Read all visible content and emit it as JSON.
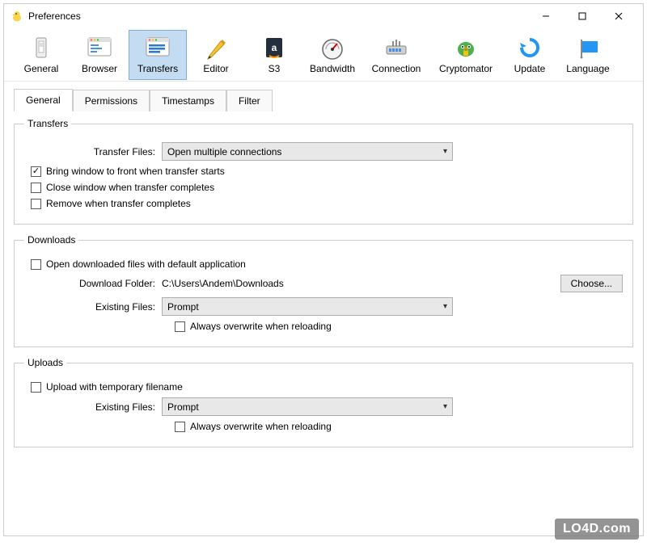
{
  "window": {
    "title": "Preferences"
  },
  "toolbar": {
    "items": [
      {
        "label": "General"
      },
      {
        "label": "Browser"
      },
      {
        "label": "Transfers"
      },
      {
        "label": "Editor"
      },
      {
        "label": "S3"
      },
      {
        "label": "Bandwidth"
      },
      {
        "label": "Connection"
      },
      {
        "label": "Cryptomator"
      },
      {
        "label": "Update"
      },
      {
        "label": "Language"
      }
    ]
  },
  "subtabs": {
    "items": [
      {
        "label": "General"
      },
      {
        "label": "Permissions"
      },
      {
        "label": "Timestamps"
      },
      {
        "label": "Filter"
      }
    ]
  },
  "transfers_group": {
    "legend": "Transfers",
    "transfer_files_label": "Transfer Files:",
    "transfer_files_value": "Open multiple connections",
    "cb_bring_front": "Bring window to front when transfer starts",
    "cb_close_complete": "Close window when transfer completes",
    "cb_remove_complete": "Remove when transfer completes"
  },
  "downloads_group": {
    "legend": "Downloads",
    "cb_open_default": "Open downloaded files with default application",
    "download_folder_label": "Download Folder:",
    "download_folder_value": "C:\\Users\\Andem\\Downloads",
    "choose_btn": "Choose...",
    "existing_files_label": "Existing Files:",
    "existing_files_value": "Prompt",
    "cb_always_overwrite": "Always overwrite when reloading"
  },
  "uploads_group": {
    "legend": "Uploads",
    "cb_temp_filename": "Upload with temporary filename",
    "existing_files_label": "Existing Files:",
    "existing_files_value": "Prompt",
    "cb_always_overwrite": "Always overwrite when reloading"
  },
  "watermark": "LO4D.com"
}
